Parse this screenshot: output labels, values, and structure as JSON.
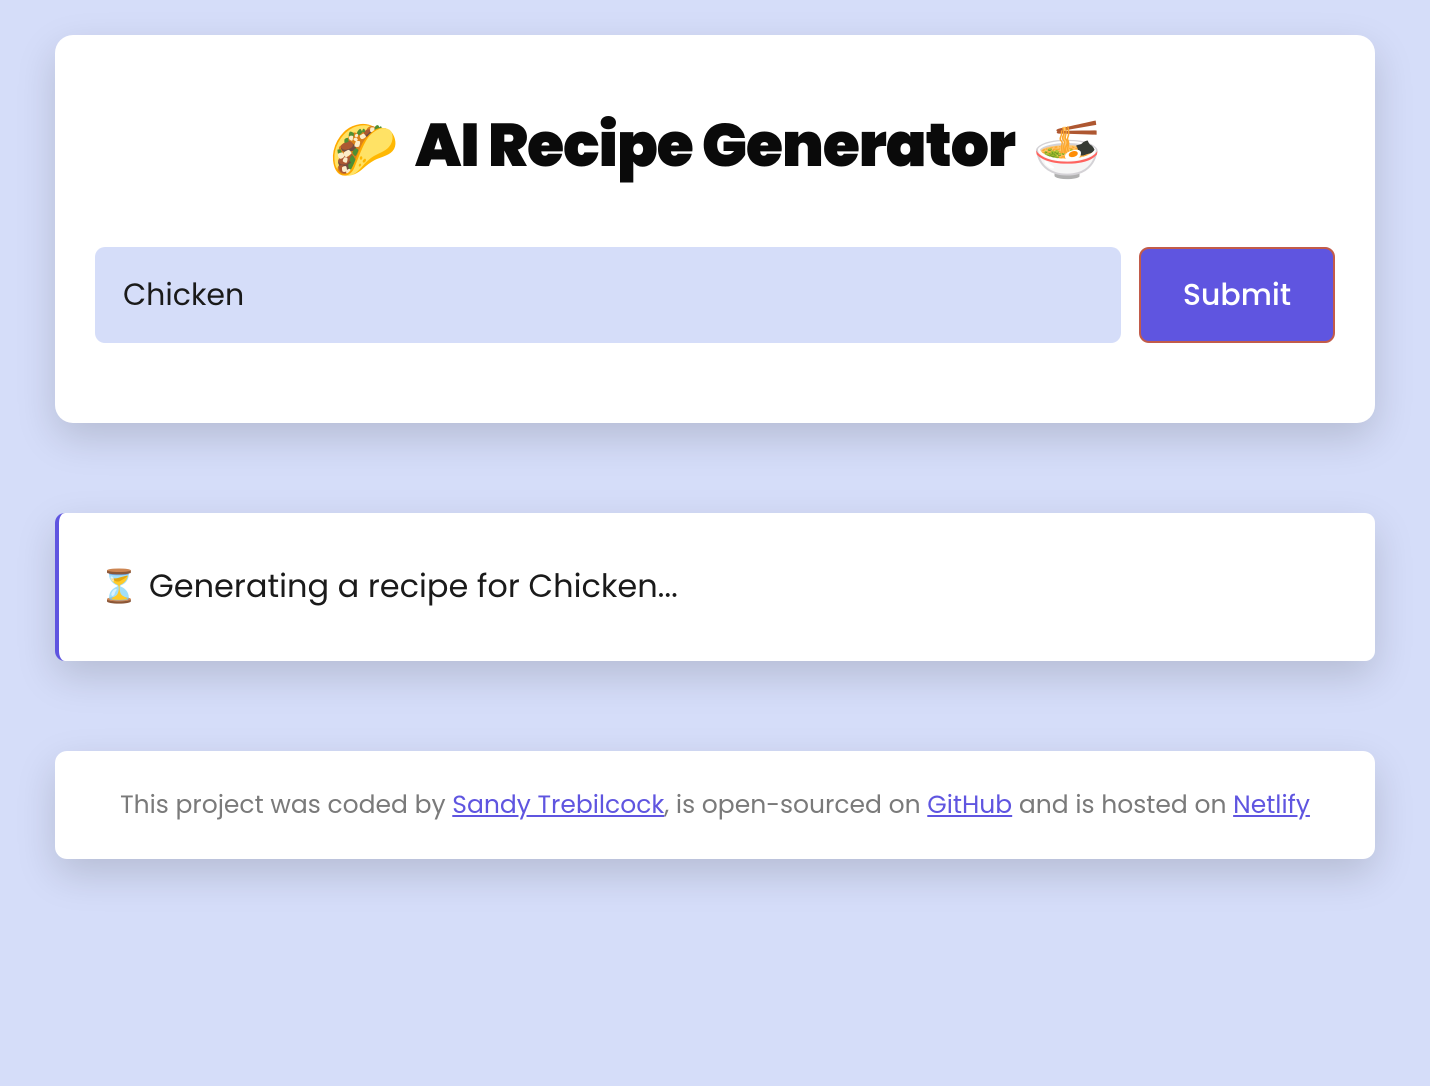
{
  "header": {
    "emoji_left": "🌮",
    "title": "AI Recipe Generator",
    "emoji_right": "🍜"
  },
  "form": {
    "input_value": "Chicken",
    "input_placeholder": "",
    "submit_label": "Submit"
  },
  "status": {
    "icon": "⏳",
    "message": "Generating a recipe for Chicken..."
  },
  "footer": {
    "text_prefix": "This project was coded by ",
    "author_link": "Sandy Trebilcock",
    "text_mid1": ", is open-sourced on ",
    "github_link": "GitHub",
    "text_mid2": " and is hosted on ",
    "netlify_link": "Netlify"
  },
  "colors": {
    "background": "#d5ddf9",
    "card_bg": "#ffffff",
    "accent": "#5f55e0",
    "button_border": "#c25b4a",
    "link": "#5f55e0",
    "text_dark": "#1a1a1a",
    "text_muted": "#7a7a7a"
  }
}
